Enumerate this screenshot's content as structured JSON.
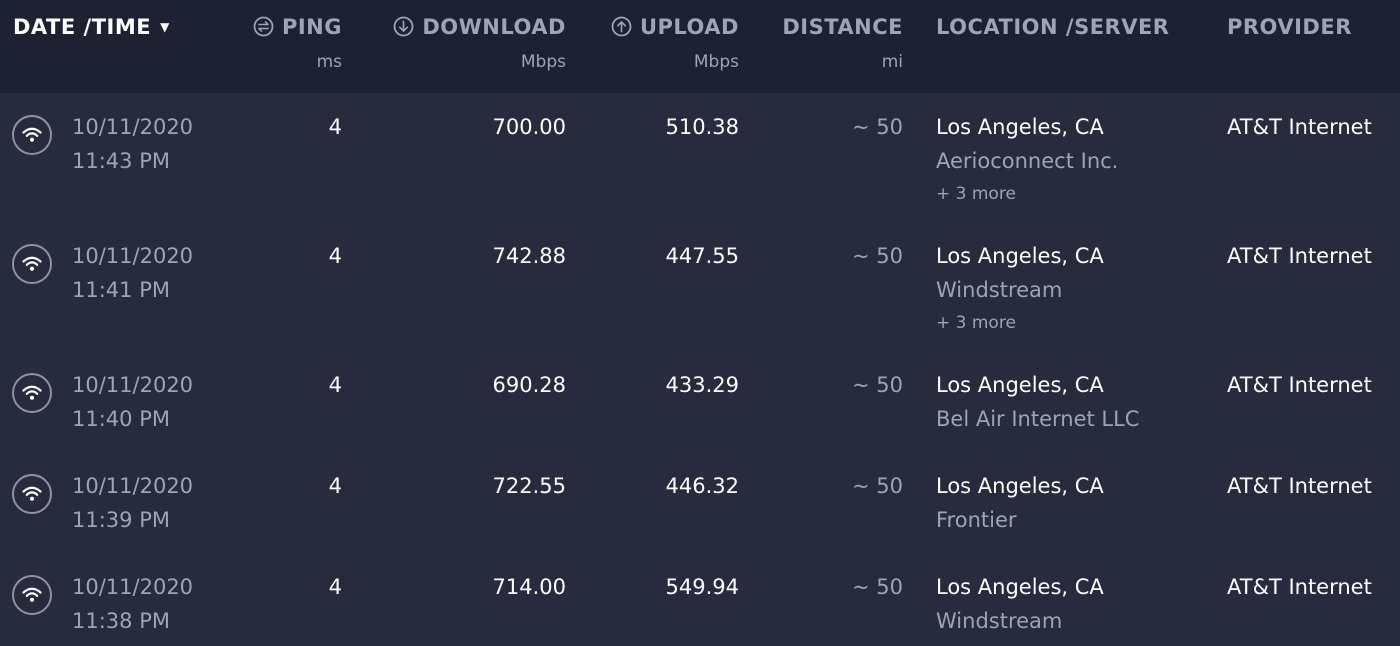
{
  "header": {
    "date_time": "DATE /TIME",
    "ping": "PING",
    "ping_unit": "ms",
    "download": "DOWNLOAD",
    "download_unit": "Mbps",
    "upload": "UPLOAD",
    "upload_unit": "Mbps",
    "distance": "DISTANCE",
    "distance_unit": "mi",
    "location_server": "LOCATION /SERVER",
    "provider": "PROVIDER"
  },
  "rows": [
    {
      "date": "10/11/2020",
      "time": "11:43 PM",
      "ping": "4",
      "download": "700.00",
      "upload": "510.38",
      "distance": "~ 50",
      "location": "Los Angeles, CA",
      "server": "Aerioconnect Inc.",
      "more": "+ 3 more",
      "provider": "AT&T Internet"
    },
    {
      "date": "10/11/2020",
      "time": "11:41 PM",
      "ping": "4",
      "download": "742.88",
      "upload": "447.55",
      "distance": "~ 50",
      "location": "Los Angeles, CA",
      "server": "Windstream",
      "more": "+ 3 more",
      "provider": "AT&T Internet"
    },
    {
      "date": "10/11/2020",
      "time": "11:40 PM",
      "ping": "4",
      "download": "690.28",
      "upload": "433.29",
      "distance": "~ 50",
      "location": "Los Angeles, CA",
      "server": "Bel Air Internet LLC",
      "more": "",
      "provider": "AT&T Internet"
    },
    {
      "date": "10/11/2020",
      "time": "11:39 PM",
      "ping": "4",
      "download": "722.55",
      "upload": "446.32",
      "distance": "~ 50",
      "location": "Los Angeles, CA",
      "server": "Frontier",
      "more": "",
      "provider": "AT&T Internet"
    },
    {
      "date": "10/11/2020",
      "time": "11:38 PM",
      "ping": "4",
      "download": "714.00",
      "upload": "549.94",
      "distance": "~ 50",
      "location": "Los Angeles, CA",
      "server": "Windstream",
      "more": "",
      "provider": "AT&T Internet"
    }
  ],
  "icons": {
    "sort": "caret-down-icon",
    "ping": "ping-icon",
    "download": "download-arrow-icon",
    "upload": "upload-arrow-icon",
    "connection": "wifi-icon"
  },
  "colors": {
    "background": "#272b3d",
    "header_background": "#1e2131",
    "text_primary": "#ffffff",
    "text_muted": "#9fa3b3"
  }
}
